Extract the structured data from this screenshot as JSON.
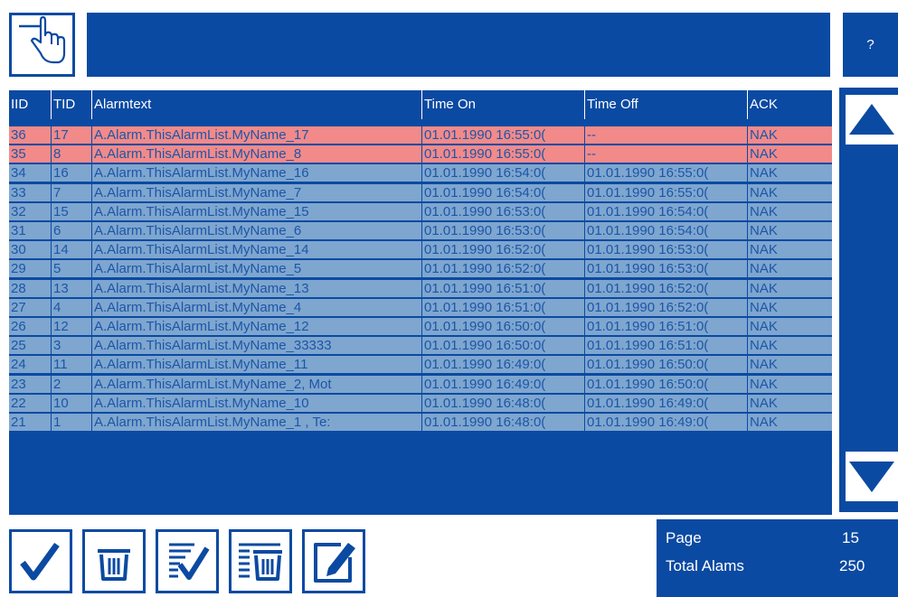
{
  "header": {
    "help_label": "?"
  },
  "table": {
    "columns": [
      "IID",
      "TID",
      "Alarmtext",
      "Time On",
      "Time Off",
      "ACK"
    ],
    "rows": [
      {
        "iid": "36",
        "tid": "17",
        "text": "A.Alarm.ThisAlarmList.MyName_17",
        "on": "01.01.1990 16:55:0(",
        "off": "--",
        "ack": "NAK",
        "state": "active"
      },
      {
        "iid": "35",
        "tid": "8",
        "text": "A.Alarm.ThisAlarmList.MyName_8",
        "on": "01.01.1990 16:55:0(",
        "off": "--",
        "ack": "NAK",
        "state": "active"
      },
      {
        "iid": "34",
        "tid": "16",
        "text": "A.Alarm.ThisAlarmList.MyName_16",
        "on": "01.01.1990 16:54:0(",
        "off": "01.01.1990 16:55:0(",
        "ack": "NAK",
        "state": "gone"
      },
      {
        "iid": "33",
        "tid": "7",
        "text": "A.Alarm.ThisAlarmList.MyName_7",
        "on": "01.01.1990 16:54:0(",
        "off": "01.01.1990 16:55:0(",
        "ack": "NAK",
        "state": "gone"
      },
      {
        "iid": "32",
        "tid": "15",
        "text": "A.Alarm.ThisAlarmList.MyName_15",
        "on": "01.01.1990 16:53:0(",
        "off": "01.01.1990 16:54:0(",
        "ack": "NAK",
        "state": "gone"
      },
      {
        "iid": "31",
        "tid": "6",
        "text": "A.Alarm.ThisAlarmList.MyName_6",
        "on": "01.01.1990 16:53:0(",
        "off": "01.01.1990 16:54:0(",
        "ack": "NAK",
        "state": "gone"
      },
      {
        "iid": "30",
        "tid": "14",
        "text": "A.Alarm.ThisAlarmList.MyName_14",
        "on": "01.01.1990 16:52:0(",
        "off": "01.01.1990 16:53:0(",
        "ack": "NAK",
        "state": "gone"
      },
      {
        "iid": "29",
        "tid": "5",
        "text": "A.Alarm.ThisAlarmList.MyName_5",
        "on": "01.01.1990 16:52:0(",
        "off": "01.01.1990 16:53:0(",
        "ack": "NAK",
        "state": "gone"
      },
      {
        "iid": "28",
        "tid": "13",
        "text": "A.Alarm.ThisAlarmList.MyName_13",
        "on": "01.01.1990 16:51:0(",
        "off": "01.01.1990 16:52:0(",
        "ack": "NAK",
        "state": "gone"
      },
      {
        "iid": "27",
        "tid": "4",
        "text": "A.Alarm.ThisAlarmList.MyName_4",
        "on": "01.01.1990 16:51:0(",
        "off": "01.01.1990 16:52:0(",
        "ack": "NAK",
        "state": "gone"
      },
      {
        "iid": "26",
        "tid": "12",
        "text": "A.Alarm.ThisAlarmList.MyName_12",
        "on": "01.01.1990 16:50:0(",
        "off": "01.01.1990 16:51:0(",
        "ack": "NAK",
        "state": "gone"
      },
      {
        "iid": "25",
        "tid": "3",
        "text": "A.Alarm.ThisAlarmList.MyName_33333",
        "on": "01.01.1990 16:50:0(",
        "off": "01.01.1990 16:51:0(",
        "ack": "NAK",
        "state": "gone"
      },
      {
        "iid": "24",
        "tid": "11",
        "text": "A.Alarm.ThisAlarmList.MyName_11",
        "on": "01.01.1990 16:49:0(",
        "off": "01.01.1990 16:50:0(",
        "ack": "NAK",
        "state": "gone"
      },
      {
        "iid": "23",
        "tid": "2",
        "text": "A.Alarm.ThisAlarmList.MyName_2, Mot",
        "on": "01.01.1990 16:49:0(",
        "off": "01.01.1990 16:50:0(",
        "ack": "NAK",
        "state": "gone"
      },
      {
        "iid": "22",
        "tid": "10",
        "text": "A.Alarm.ThisAlarmList.MyName_10",
        "on": "01.01.1990 16:48:0(",
        "off": "01.01.1990 16:49:0(",
        "ack": "NAK",
        "state": "gone"
      },
      {
        "iid": "21",
        "tid": "1",
        "text": "A.Alarm.ThisAlarmList.MyName_1 , Te:",
        "on": "01.01.1990 16:48:0(",
        "off": "01.01.1990 16:49:0(",
        "ack": "NAK",
        "state": "gone"
      }
    ]
  },
  "info": {
    "page_label": "Page",
    "page_value": "15",
    "total_label": "Total Alams",
    "total_value": "250"
  },
  "colors": {
    "primary": "#0b4aa2",
    "row_gone": "#7ea6cf",
    "row_active": "#f28a8a",
    "row_text": "#1d56a8"
  },
  "icons": {
    "hand": "hand-pointer-icon",
    "scroll_up": "arrow-up-icon",
    "scroll_down": "arrow-down-icon",
    "ack": "checkmark-icon",
    "delete": "trash-icon",
    "ack_all": "checklist-icon",
    "delete_all": "list-trash-icon",
    "edit": "edit-icon"
  }
}
